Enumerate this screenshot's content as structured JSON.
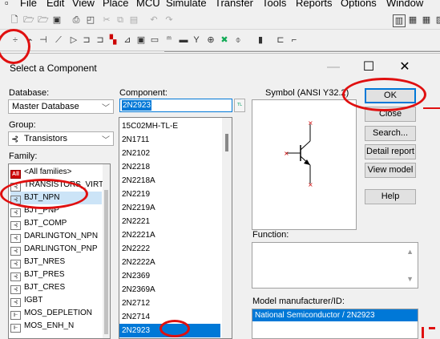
{
  "menu": [
    "File",
    "Edit",
    "View",
    "Place",
    "MCU",
    "Simulate",
    "Transfer",
    "Tools",
    "Reports",
    "Options",
    "Window"
  ],
  "dialog": {
    "title": "Select a Component",
    "database_label": "Database:",
    "database_value": "Master Database",
    "group_label": "Group:",
    "group_value": "Transistors",
    "family_label": "Family:",
    "families": [
      "<All families>",
      "TRANSISTORS_VIRTUAL",
      "BJT_NPN",
      "BJT_PNP",
      "BJT_COMP",
      "DARLINGTON_NPN",
      "DARLINGTON_PNP",
      "BJT_NRES",
      "BJT_PRES",
      "BJT_CRES",
      "IGBT",
      "MOS_DEPLETION",
      "MOS_ENH_N"
    ],
    "component_label": "Component:",
    "component_value": "2N2923",
    "components": [
      "15C02MH-TL-E",
      "2N1711",
      "2N2102",
      "2N2218",
      "2N2218A",
      "2N2219",
      "2N2219A",
      "2N2221",
      "2N2221A",
      "2N2222",
      "2N2222A",
      "2N2369",
      "2N2369A",
      "2N2712",
      "2N2714",
      "2N2923"
    ],
    "symbol_label": "Symbol (ANSI Y32.2)",
    "buttons": {
      "ok": "OK",
      "close": "Close",
      "search": "Search...",
      "detail": "Detail report",
      "view_model": "View model",
      "help": "Help"
    },
    "function_label": "Function:",
    "model_label": "Model manufacturer/ID:",
    "model_value": "National Semiconductor / 2N2923"
  },
  "colors": {
    "annotation": "#e01010",
    "selection": "#0078d7"
  }
}
